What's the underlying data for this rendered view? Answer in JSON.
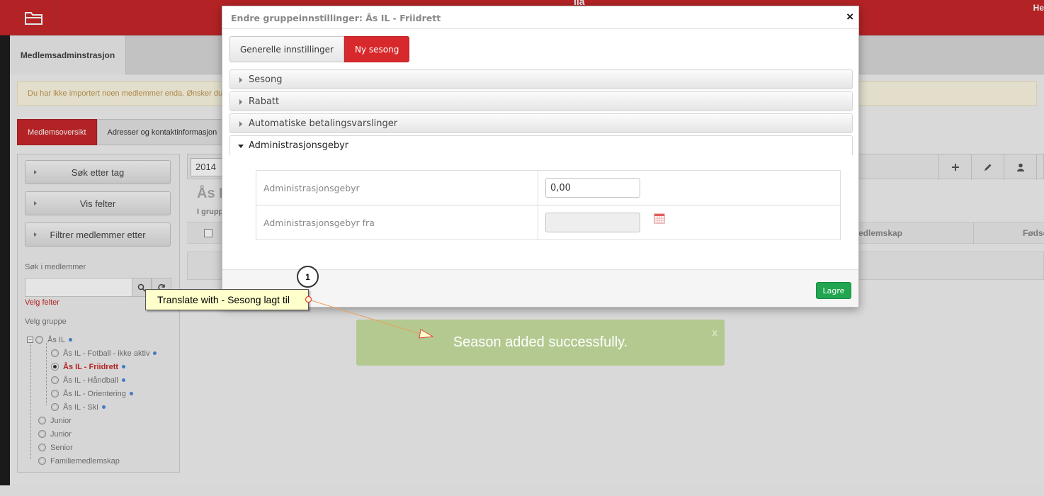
{
  "topbar": {
    "user_fragment": "He",
    "logo_fragment": "ila"
  },
  "tabbar": {
    "active_tab": "Medlemsadminstrasjon"
  },
  "warning": {
    "text": "Du har ikke importert noen medlemmer enda. Ønsker du å"
  },
  "subtabs": [
    {
      "label": "Medlemsoversikt"
    },
    {
      "label": "Adresser og kontaktinformasjon"
    }
  ],
  "sidebar": {
    "buttons": [
      {
        "label": "Søk etter tag"
      },
      {
        "label": "Vis felter"
      },
      {
        "label": "Filtrer medlemmer etter"
      }
    ],
    "search_label": "Søk i medlemmer",
    "search_value": "",
    "velg_felter": "Velg felter",
    "velg_gruppe": "Velg gruppe",
    "tree": [
      {
        "label": "Ås IL"
      },
      {
        "label": "Ås IL - Fotball - ikke aktiv"
      },
      {
        "label": "Ås IL - Friidrett",
        "selected": true
      },
      {
        "label": "Ås IL - Håndball"
      },
      {
        "label": "Ås IL - Orientering"
      },
      {
        "label": "Ås IL - Ski"
      },
      {
        "label": "Junior"
      },
      {
        "label": "Junior"
      },
      {
        "label": "Senior"
      },
      {
        "label": "Familiemedlemskap"
      }
    ]
  },
  "main": {
    "year": "2014",
    "group_title": "Ås I",
    "group_sub": "I grupp",
    "columns": [
      "edlemskap",
      "Fødse"
    ]
  },
  "modal": {
    "title": "Endre gruppeinnstillinger: Ås IL - Friidrett",
    "close": "×",
    "tabs": [
      {
        "label": "Generelle innstillinger",
        "active": false
      },
      {
        "label": "Ny sesong",
        "active": true
      }
    ],
    "sections": [
      {
        "label": "Sesong",
        "open": false
      },
      {
        "label": "Rabatt",
        "open": false
      },
      {
        "label": "Automatiske betalingsvarslinger",
        "open": false
      },
      {
        "label": "Administrasjonsgebyr",
        "open": true
      }
    ],
    "fields": [
      {
        "label": "Administrasjonsgebyr",
        "value": "0,00"
      },
      {
        "label": "Administrasjonsgebyr fra",
        "value": ""
      }
    ],
    "save_label": "Lagre"
  },
  "toast": {
    "message": "Season added successfully.",
    "close": "x"
  },
  "annotation": {
    "step": "1",
    "callout": "Translate with - Sesong lagt til"
  },
  "colors": {
    "brand_red": "#c8282a",
    "save_green": "#21a550",
    "toast_green": "#b3c990",
    "callout_yellow": "#ffffcc"
  }
}
